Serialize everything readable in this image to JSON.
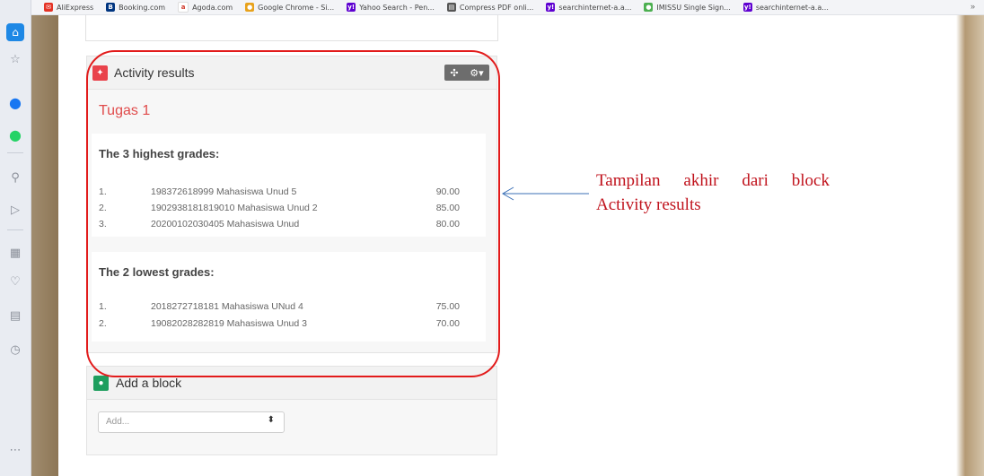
{
  "bookmarks": [
    {
      "label": "AliExpress",
      "icon": "aliexpress-icon",
      "color": "#e43225",
      "glyph": "✉"
    },
    {
      "label": "Booking.com",
      "icon": "booking-icon",
      "color": "#003580",
      "glyph": "B"
    },
    {
      "label": "Agoda.com",
      "icon": "agoda-icon",
      "color": "#ffffff",
      "glyph": "a"
    },
    {
      "label": "Google Chrome - Si...",
      "icon": "chrome-icon",
      "color": "#e8a21c",
      "glyph": "●"
    },
    {
      "label": "Yahoo Search - Pen...",
      "icon": "yahoo-icon",
      "color": "#5f01d1",
      "glyph": "y!"
    },
    {
      "label": "Compress PDF onli...",
      "icon": "document-icon",
      "color": "#555555",
      "glyph": "▤"
    },
    {
      "label": "searchinternet-a.a...",
      "icon": "yahoo-icon",
      "color": "#5f01d1",
      "glyph": "y!"
    },
    {
      "label": "IMISSU Single Sign...",
      "icon": "globe-icon",
      "color": "#4caf50",
      "glyph": "●"
    },
    {
      "label": "searchinternet-a.a...",
      "icon": "yahoo-icon",
      "color": "#5f01d1",
      "glyph": "y!"
    }
  ],
  "bookmarks_more": "»",
  "activity_block": {
    "title": "Activity results",
    "controls": {
      "move": "✣",
      "settings": "⚙▾"
    },
    "activity_name": "Tugas 1",
    "highest": {
      "heading": "The 3 highest grades:",
      "rows": [
        {
          "rank": "1.",
          "name": "198372618999 Mahasiswa Unud 5",
          "score": "90.00"
        },
        {
          "rank": "2.",
          "name": "1902938181819010 Mahasiswa Unud 2",
          "score": "85.00"
        },
        {
          "rank": "3.",
          "name": "20200102030405 Mahasiswa Unud",
          "score": "80.00"
        }
      ]
    },
    "lowest": {
      "heading": "The 2 lowest grades:",
      "rows": [
        {
          "rank": "1.",
          "name": "2018272718181 Mahasiswa UNud 4",
          "score": "75.00"
        },
        {
          "rank": "2.",
          "name": "19082028282819 Mahasiswa Unud 3",
          "score": "70.00"
        }
      ]
    }
  },
  "add_block": {
    "title": "Add a block",
    "select_value": "Add...",
    "select_arrow": "⬍"
  },
  "annotation": {
    "text": "Tampilan akhir dari block Activity results",
    "color": "#c0121c"
  }
}
